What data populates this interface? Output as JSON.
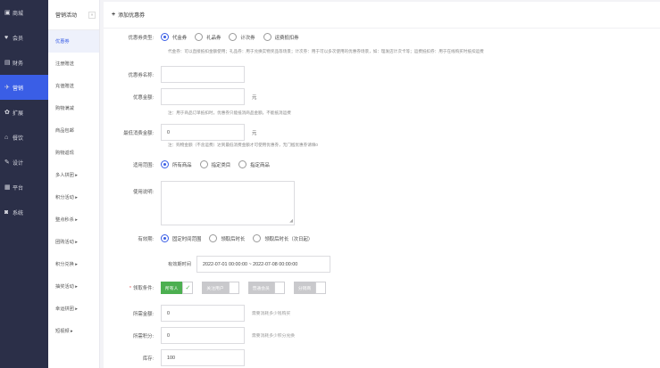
{
  "sidebar": {
    "items": [
      {
        "icon": "store-icon",
        "glyph": "▣",
        "label": "商城"
      },
      {
        "icon": "heart-icon",
        "glyph": "♥",
        "label": "会员"
      },
      {
        "icon": "finance-icon",
        "glyph": "▤",
        "label": "财务"
      },
      {
        "icon": "marketing-icon",
        "glyph": "✈",
        "label": "营销",
        "active": true
      },
      {
        "icon": "extend-icon",
        "glyph": "✿",
        "label": "扩展"
      },
      {
        "icon": "restaurant-icon",
        "glyph": "⌂",
        "label": "餐饮"
      },
      {
        "icon": "design-icon",
        "glyph": "✎",
        "label": "设计"
      },
      {
        "icon": "platform-icon",
        "glyph": "▦",
        "label": "平台"
      },
      {
        "icon": "system-icon",
        "glyph": "◙",
        "label": "系统"
      }
    ]
  },
  "subnav": {
    "title": "营销活动",
    "items": [
      {
        "label": "优惠券",
        "active": true
      },
      {
        "label": "注册赠送"
      },
      {
        "label": "充值赠送"
      },
      {
        "label": "购物满减"
      },
      {
        "label": "商品包邮"
      },
      {
        "label": "购物返现"
      },
      {
        "label": "多人拼团 ▸"
      },
      {
        "label": "积分活动 ▸"
      },
      {
        "label": "整点秒杀 ▸"
      },
      {
        "label": "团购活动 ▸"
      },
      {
        "label": "积分兑换 ▸"
      },
      {
        "label": "抽奖活动 ▸"
      },
      {
        "label": "幸运拼团 ▸"
      },
      {
        "label": "短视频 ▸"
      }
    ]
  },
  "main": {
    "header": "添加优惠券",
    "coupon_type": {
      "label": "优惠券类型:",
      "options": [
        "代金券",
        "礼品券",
        "计次券",
        "运费抵扣券"
      ],
      "selected": 0,
      "note": "代金券：可以直接抵扣金额使用；礼品券：用于兑换实物奖品等场景；计次券：用于可以多次使用的优惠券场景，如：理发店计次卡等；运费抵扣券：用于在线购买时抵扣运费"
    },
    "coupon_name": {
      "label": "优惠券名称:",
      "value": ""
    },
    "coupon_amount": {
      "label": "优惠金额:",
      "value": "",
      "suffix": "元",
      "note": "注：用于商品订单抵扣时，优惠券只能抵消商品金额，不能抵消运费"
    },
    "min_amount": {
      "label": "最低消费金额:",
      "value": "0",
      "suffix": "元",
      "note": "注：购物金额（不含运费）达到最低消费金额才可使用优惠券，无门槛优惠券请填0"
    },
    "scope": {
      "label": "适用范围:",
      "options": [
        "所有商品",
        "指定类目",
        "指定商品"
      ],
      "selected": 0
    },
    "usage_desc": {
      "label": "使用说明:"
    },
    "validity": {
      "label": "有效期:",
      "options": [
        "固定时间范围",
        "领取后时长",
        "领取后时长（次日起）"
      ],
      "selected": 0,
      "range_label": "有效期时间",
      "range_value": "2022-07-01 00:00:00 ~ 2022-07-08 00:00:00"
    },
    "receive_condition": {
      "label": "领取条件:",
      "tags": [
        {
          "label": "所有人",
          "checked": true
        },
        {
          "label": "关注用户",
          "checked": false
        },
        {
          "label": "普通会员",
          "checked": false
        },
        {
          "label": "分销商",
          "checked": false
        }
      ]
    },
    "required_amount": {
      "label": "所需金额:",
      "value": "0",
      "hint": "需要消耗多少钱购买"
    },
    "required_points": {
      "label": "所需积分:",
      "value": "0",
      "hint": "需要消耗多少积分兑换"
    },
    "stock": {
      "label": "库存:",
      "value": "100"
    }
  }
}
